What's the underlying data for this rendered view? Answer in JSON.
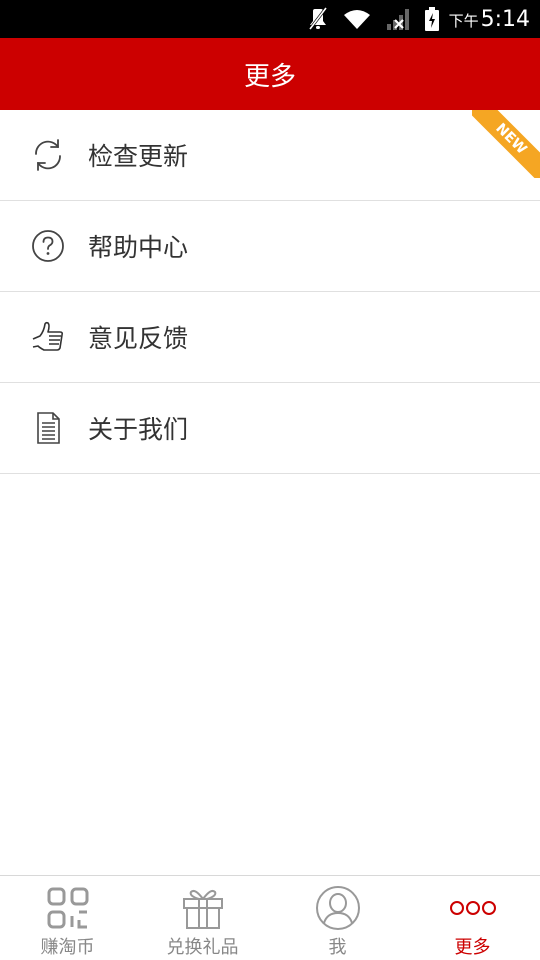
{
  "status_bar": {
    "ampm": "下午",
    "time": "5:14",
    "icons": [
      "mute-icon",
      "wifi-icon",
      "signal-icon",
      "battery-icon"
    ]
  },
  "header": {
    "title": "更多"
  },
  "menu": {
    "items": [
      {
        "label": "检查更新",
        "icon": "refresh-icon",
        "badge": "NEW"
      },
      {
        "label": "帮助中心",
        "icon": "help-icon"
      },
      {
        "label": "意见反馈",
        "icon": "thumbs-up-icon"
      },
      {
        "label": "关于我们",
        "icon": "document-icon"
      }
    ]
  },
  "bottom_nav": {
    "items": [
      {
        "label": "赚淘币",
        "icon": "qr-grid-icon"
      },
      {
        "label": "兑换礼品",
        "icon": "gift-icon"
      },
      {
        "label": "我",
        "icon": "user-icon"
      },
      {
        "label": "更多",
        "icon": "more-dots-icon",
        "active": true
      }
    ]
  },
  "colors": {
    "accent": "#cc0000",
    "ribbon": "#f5a623",
    "text": "#333333",
    "nav_inactive": "#888888"
  }
}
